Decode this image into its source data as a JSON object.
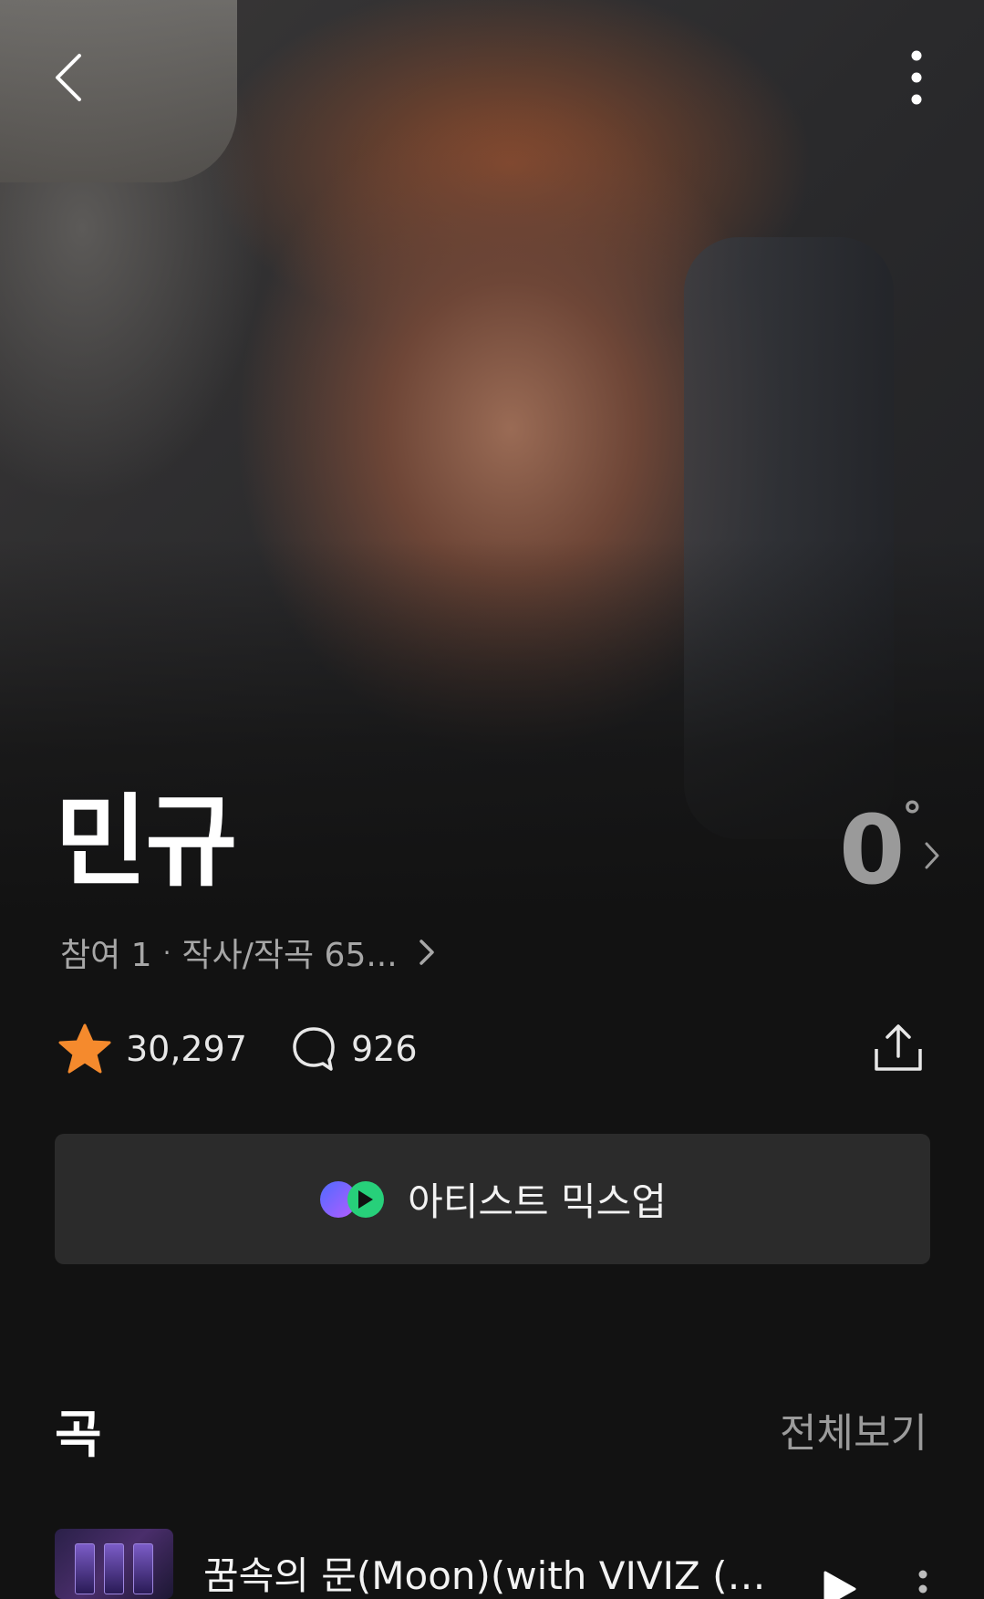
{
  "artist": {
    "name": "민규",
    "temperature": "0",
    "temperature_unit": "°",
    "participation": "참여 1",
    "credits": "작사/작곡 65..."
  },
  "stats": {
    "likes": "30,297",
    "comments": "926"
  },
  "mixup": {
    "label": "아티스트 믹스업"
  },
  "songs_section": {
    "title": "곡",
    "view_all": "전체보기",
    "items": [
      {
        "title": "꿈속의 문(Moon)(with VIVIZ (비..."
      }
    ]
  },
  "colors": {
    "background": "#121212",
    "star": "#F58A2D",
    "button_bg": "#2B2B2B",
    "muted_text": "#9B9B9B"
  },
  "icons": [
    "back-arrow-icon",
    "more-vertical-icon",
    "chevron-right-icon",
    "star-icon",
    "comment-icon",
    "share-icon",
    "mixup-logo-icon",
    "play-icon"
  ]
}
